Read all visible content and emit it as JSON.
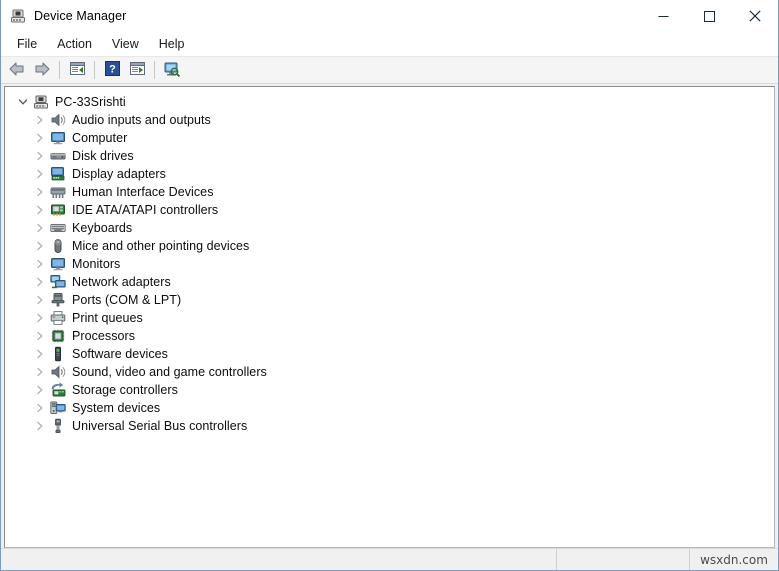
{
  "window": {
    "title": "Device Manager",
    "title_icon": "device-manager-icon"
  },
  "caption": {
    "minimize_label": "Minimize",
    "maximize_label": "Maximize",
    "close_label": "Close"
  },
  "menubar": {
    "items": [
      {
        "label": "File"
      },
      {
        "label": "Action"
      },
      {
        "label": "View"
      },
      {
        "label": "Help"
      }
    ]
  },
  "toolbar": {
    "buttons": [
      {
        "name": "back-button",
        "icon": "back-arrow-icon",
        "label": "Back"
      },
      {
        "name": "forward-button",
        "icon": "forward-arrow-icon",
        "label": "Forward"
      },
      {
        "name": "show-hide-console-tree",
        "icon": "console-tree-icon",
        "label": "Show/Hide Console Tree"
      },
      {
        "name": "help-button",
        "icon": "help-question-icon",
        "label": "Help"
      },
      {
        "name": "properties-button",
        "icon": "properties-icon",
        "label": "Properties"
      },
      {
        "name": "scan-hardware-button",
        "icon": "scan-for-changes-icon",
        "label": "Scan for hardware changes"
      }
    ]
  },
  "tree": {
    "root": {
      "label": "PC-33Srishti",
      "icon": "computer-root-icon",
      "expanded": true,
      "twisty": "chevron-down"
    },
    "nodes": [
      {
        "label": "Audio inputs and outputs",
        "icon": "speaker-icon",
        "twisty": "chevron-right"
      },
      {
        "label": "Computer",
        "icon": "monitor-icon",
        "twisty": "chevron-right"
      },
      {
        "label": "Disk drives",
        "icon": "disk-drive-icon",
        "twisty": "chevron-right"
      },
      {
        "label": "Display adapters",
        "icon": "display-adapter-icon",
        "twisty": "chevron-right"
      },
      {
        "label": "Human Interface Devices",
        "icon": "hid-icon",
        "twisty": "chevron-right"
      },
      {
        "label": "IDE ATA/ATAPI controllers",
        "icon": "ide-controller-icon",
        "twisty": "chevron-right"
      },
      {
        "label": "Keyboards",
        "icon": "keyboard-icon",
        "twisty": "chevron-right"
      },
      {
        "label": "Mice and other pointing devices",
        "icon": "mouse-icon",
        "twisty": "chevron-right"
      },
      {
        "label": "Monitors",
        "icon": "monitor-icon",
        "twisty": "chevron-right"
      },
      {
        "label": "Network adapters",
        "icon": "network-adapter-icon",
        "twisty": "chevron-right"
      },
      {
        "label": "Ports (COM & LPT)",
        "icon": "port-icon",
        "twisty": "chevron-right"
      },
      {
        "label": "Print queues",
        "icon": "printer-icon",
        "twisty": "chevron-right"
      },
      {
        "label": "Processors",
        "icon": "processor-icon",
        "twisty": "chevron-right"
      },
      {
        "label": "Software devices",
        "icon": "software-device-icon",
        "twisty": "chevron-right"
      },
      {
        "label": "Sound, video and game controllers",
        "icon": "speaker-icon",
        "twisty": "chevron-right"
      },
      {
        "label": "Storage controllers",
        "icon": "storage-controller-icon",
        "twisty": "chevron-right"
      },
      {
        "label": "System devices",
        "icon": "system-device-icon",
        "twisty": "chevron-right"
      },
      {
        "label": "Universal Serial Bus controllers",
        "icon": "usb-icon",
        "twisty": "chevron-right"
      }
    ]
  },
  "statusbar": {
    "main_text": "",
    "mid_text": "",
    "right_text": "wsxdn.com"
  },
  "colors": {
    "window_border": "#7a9bbd",
    "toolbar_bg": "#f5f5f5",
    "status_bg": "#f0f0f0",
    "tree_bg": "#ffffff",
    "text": "#0c0c0c",
    "twisty": "#b0b0b0",
    "accent_blue": "#2f6fb5"
  }
}
